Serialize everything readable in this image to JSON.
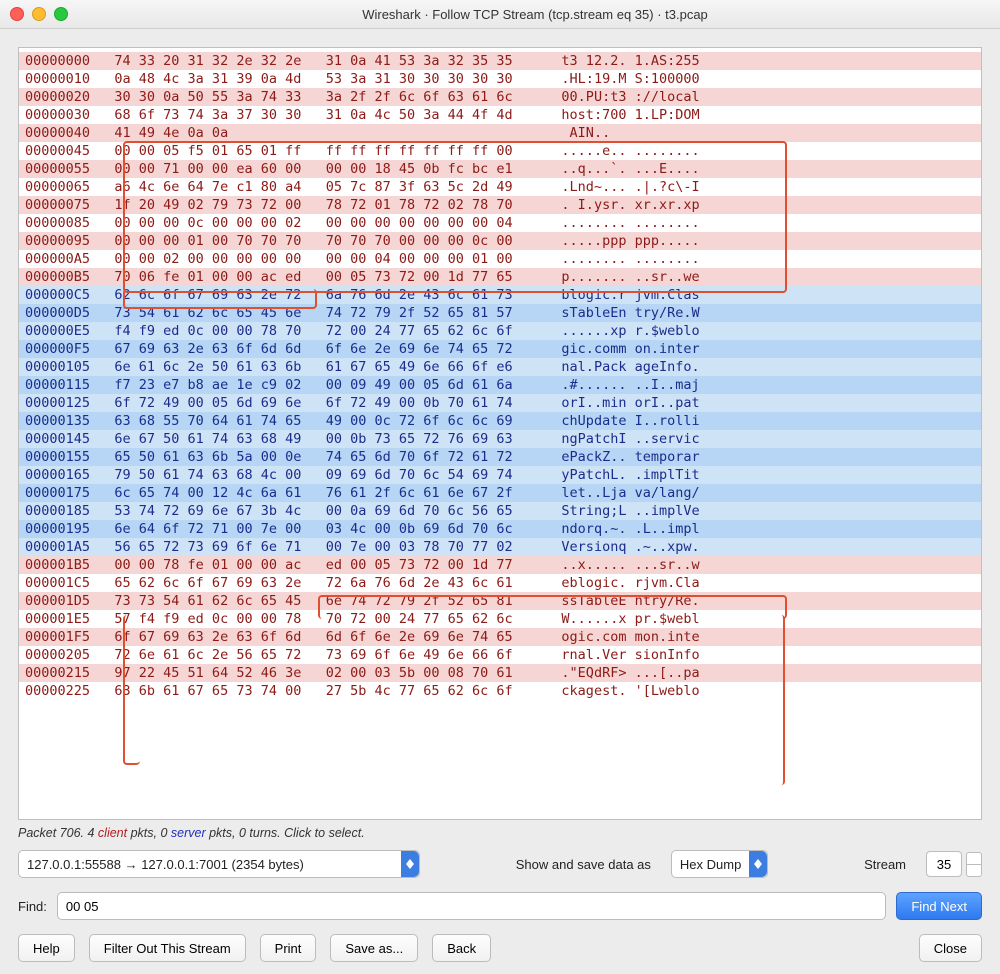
{
  "window": {
    "title": "Wireshark · Follow TCP Stream (tcp.stream eq 35) · t3.pcap"
  },
  "hex": {
    "rows": [
      {
        "dir": "cli",
        "hl": true,
        "off": "00000000",
        "b1": "74 33 20 31 32 2e 32 2e",
        "b2": "31 0a 41 53 3a 32 35 35",
        "asc": "t3 12.2. 1.AS:255"
      },
      {
        "dir": "cli",
        "hl": false,
        "off": "00000010",
        "b1": "0a 48 4c 3a 31 39 0a 4d",
        "b2": "53 3a 31 30 30 30 30 30",
        "asc": ".HL:19.M S:100000"
      },
      {
        "dir": "cli",
        "hl": true,
        "off": "00000020",
        "b1": "30 30 0a 50 55 3a 74 33",
        "b2": "3a 2f 2f 6c 6f 63 61 6c",
        "asc": "00.PU:t3 ://local"
      },
      {
        "dir": "cli",
        "hl": false,
        "off": "00000030",
        "b1": "68 6f 73 74 3a 37 30 30",
        "b2": "31 0a 4c 50 3a 44 4f 4d",
        "asc": "host:700 1.LP:DOM"
      },
      {
        "dir": "cli",
        "hl": true,
        "off": "00000040",
        "b1": "41 49 4e 0a 0a         ",
        "b2": "                        ",
        "asc": "AIN..            "
      },
      {
        "dir": "cli",
        "hl": false,
        "off": "00000045",
        "b1": "00 00 05 f5 01 65 01 ff",
        "b2": "ff ff ff ff ff ff ff 00",
        "asc": ".....e.. ........"
      },
      {
        "dir": "cli",
        "hl": true,
        "off": "00000055",
        "b1": "00 00 71 00 00 ea 60 00",
        "b2": "00 00 18 45 0b fc bc e1",
        "asc": "..q...`. ...E...."
      },
      {
        "dir": "cli",
        "hl": false,
        "off": "00000065",
        "b1": "a6 4c 6e 64 7e c1 80 a4",
        "b2": "05 7c 87 3f 63 5c 2d 49",
        "asc": ".Lnd~... .|.?c\\-I"
      },
      {
        "dir": "cli",
        "hl": true,
        "off": "00000075",
        "b1": "1f 20 49 02 79 73 72 00",
        "b2": "78 72 01 78 72 02 78 70",
        "asc": ". I.ysr. xr.xr.xp"
      },
      {
        "dir": "cli",
        "hl": false,
        "off": "00000085",
        "b1": "00 00 00 0c 00 00 00 02",
        "b2": "00 00 00 00 00 00 00 04",
        "asc": "........ ........"
      },
      {
        "dir": "cli",
        "hl": true,
        "off": "00000095",
        "b1": "00 00 00 01 00 70 70 70",
        "b2": "70 70 70 00 00 00 0c 00",
        "asc": ".....ppp ppp....."
      },
      {
        "dir": "cli",
        "hl": false,
        "off": "000000A5",
        "b1": "00 00 02 00 00 00 00 00",
        "b2": "00 00 04 00 00 00 01 00",
        "asc": "........ ........"
      },
      {
        "dir": "cli",
        "hl": true,
        "off": "000000B5",
        "b1": "70 06 fe 01 00 00 ac ed",
        "b2": "00 05 73 72 00 1d 77 65",
        "asc": "p....... ..sr..we"
      },
      {
        "dir": "srv",
        "hl": false,
        "off": "000000C5",
        "b1": "62 6c 6f 67 69 63 2e 72",
        "b2": "6a 76 6d 2e 43 6c 61 73",
        "asc": "blogic.r jvm.Clas"
      },
      {
        "dir": "srv",
        "hl": true,
        "off": "000000D5",
        "b1": "73 54 61 62 6c 65 45 6e",
        "b2": "74 72 79 2f 52 65 81 57",
        "asc": "sTableEn try/Re.W"
      },
      {
        "dir": "srv",
        "hl": false,
        "off": "000000E5",
        "b1": "f4 f9 ed 0c 00 00 78 70",
        "b2": "72 00 24 77 65 62 6c 6f",
        "asc": "......xp r.$weblo"
      },
      {
        "dir": "srv",
        "hl": true,
        "off": "000000F5",
        "b1": "67 69 63 2e 63 6f 6d 6d",
        "b2": "6f 6e 2e 69 6e 74 65 72",
        "asc": "gic.comm on.inter"
      },
      {
        "dir": "srv",
        "hl": false,
        "off": "00000105",
        "b1": "6e 61 6c 2e 50 61 63 6b",
        "b2": "61 67 65 49 6e 66 6f e6",
        "asc": "nal.Pack ageInfo."
      },
      {
        "dir": "srv",
        "hl": true,
        "off": "00000115",
        "b1": "f7 23 e7 b8 ae 1e c9 02",
        "b2": "00 09 49 00 05 6d 61 6a",
        "asc": ".#...... ..I..maj"
      },
      {
        "dir": "srv",
        "hl": false,
        "off": "00000125",
        "b1": "6f 72 49 00 05 6d 69 6e",
        "b2": "6f 72 49 00 0b 70 61 74",
        "asc": "orI..min orI..pat"
      },
      {
        "dir": "srv",
        "hl": true,
        "off": "00000135",
        "b1": "63 68 55 70 64 61 74 65",
        "b2": "49 00 0c 72 6f 6c 6c 69",
        "asc": "chUpdate I..rolli"
      },
      {
        "dir": "srv",
        "hl": false,
        "off": "00000145",
        "b1": "6e 67 50 61 74 63 68 49",
        "b2": "00 0b 73 65 72 76 69 63",
        "asc": "ngPatchI ..servic"
      },
      {
        "dir": "srv",
        "hl": true,
        "off": "00000155",
        "b1": "65 50 61 63 6b 5a 00 0e",
        "b2": "74 65 6d 70 6f 72 61 72",
        "asc": "ePackZ.. temporar"
      },
      {
        "dir": "srv",
        "hl": false,
        "off": "00000165",
        "b1": "79 50 61 74 63 68 4c 00",
        "b2": "09 69 6d 70 6c 54 69 74",
        "asc": "yPatchL. .implTit"
      },
      {
        "dir": "srv",
        "hl": true,
        "off": "00000175",
        "b1": "6c 65 74 00 12 4c 6a 61",
        "b2": "76 61 2f 6c 61 6e 67 2f",
        "asc": "let..Lja va/lang/"
      },
      {
        "dir": "srv",
        "hl": false,
        "off": "00000185",
        "b1": "53 74 72 69 6e 67 3b 4c",
        "b2": "00 0a 69 6d 70 6c 56 65",
        "asc": "String;L ..implVe"
      },
      {
        "dir": "srv",
        "hl": true,
        "off": "00000195",
        "b1": "6e 64 6f 72 71 00 7e 00",
        "b2": "03 4c 00 0b 69 6d 70 6c",
        "asc": "ndorq.~. .L..impl"
      },
      {
        "dir": "srv",
        "hl": false,
        "off": "000001A5",
        "b1": "56 65 72 73 69 6f 6e 71",
        "b2": "00 7e 00 03 78 70 77 02",
        "asc": "Versionq .~..xpw."
      },
      {
        "dir": "cli",
        "hl": true,
        "off": "000001B5",
        "b1": "00 00 78 fe 01 00 00 ac",
        "b2": "ed 00 05 73 72 00 1d 77",
        "asc": "..x..... ...sr..w"
      },
      {
        "dir": "cli",
        "hl": false,
        "off": "000001C5",
        "b1": "65 62 6c 6f 67 69 63 2e",
        "b2": "72 6a 76 6d 2e 43 6c 61",
        "asc": "eblogic. rjvm.Cla"
      },
      {
        "dir": "cli",
        "hl": true,
        "off": "000001D5",
        "b1": "73 73 54 61 62 6c 65 45",
        "b2": "6e 74 72 79 2f 52 65 81",
        "asc": "ssTableE ntry/Re."
      },
      {
        "dir": "cli",
        "hl": false,
        "off": "000001E5",
        "b1": "57 f4 f9 ed 0c 00 00 78",
        "b2": "70 72 00 24 77 65 62 6c",
        "asc": "W......x pr.$webl"
      },
      {
        "dir": "cli",
        "hl": true,
        "off": "000001F5",
        "b1": "6f 67 69 63 2e 63 6f 6d",
        "b2": "6d 6f 6e 2e 69 6e 74 65",
        "asc": "ogic.com mon.inte"
      },
      {
        "dir": "cli",
        "hl": false,
        "off": "00000205",
        "b1": "72 6e 61 6c 2e 56 65 72",
        "b2": "73 69 6f 6e 49 6e 66 6f",
        "asc": "rnal.Ver sionInfo"
      },
      {
        "dir": "cli",
        "hl": true,
        "off": "00000215",
        "b1": "97 22 45 51 64 52 46 3e",
        "b2": "02 00 03 5b 00 08 70 61",
        "asc": ".\"EQdRF> ...[..pa"
      },
      {
        "dir": "cli",
        "hl": false,
        "off": "00000225",
        "b1": "63 6b 61 67 65 73 74 00",
        "b2": "27 5b 4c 77 65 62 6c 6f",
        "asc": "ckagest. '[Lweblo"
      }
    ]
  },
  "status": {
    "prefix": "Packet 706. 4 ",
    "client": "client",
    "mid1": " pkts, 0 ",
    "server": "server",
    "suffix": " pkts, 0 turns. Click to select."
  },
  "controls": {
    "connection": "127.0.0.1:55588 → 127.0.0.1:7001 (2354 bytes)",
    "show_label": "Show and save data as",
    "encoding": "Hex Dump",
    "stream_label": "Stream",
    "stream_value": "35"
  },
  "find": {
    "label": "Find:",
    "value": "00 05",
    "button": "Find Next"
  },
  "buttons": {
    "help": "Help",
    "filterout": "Filter Out This Stream",
    "print": "Print",
    "saveas": "Save as...",
    "back": "Back",
    "close": "Close"
  }
}
